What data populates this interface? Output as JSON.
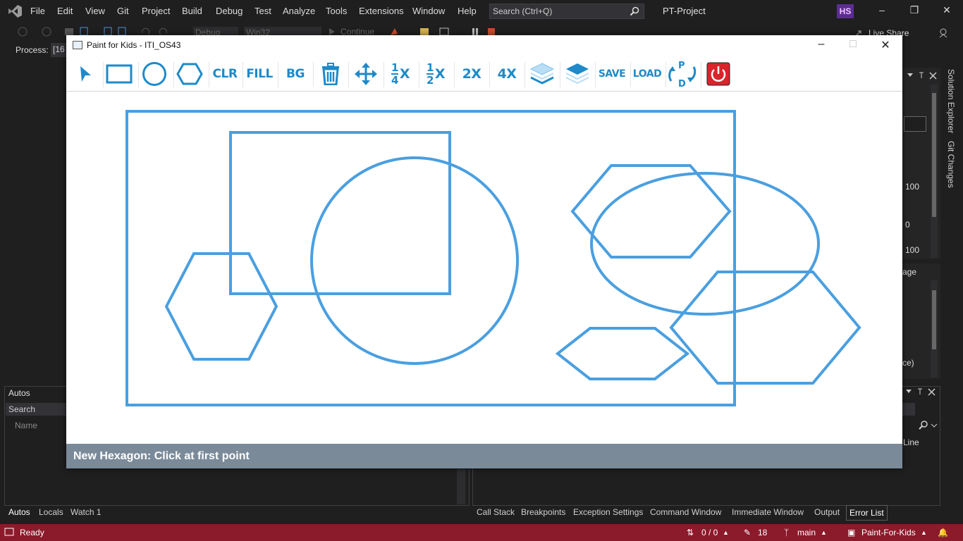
{
  "vs": {
    "menu": [
      "File",
      "Edit",
      "View",
      "Git",
      "Project",
      "Build",
      "Debug",
      "Test",
      "Analyze",
      "Tools",
      "Extensions",
      "Window",
      "Help"
    ],
    "search_placeholder": "Search (Ctrl+Q)",
    "project_name": "PT-Project",
    "avatar_initials": "HS",
    "toolbar": {
      "config": "Debug",
      "platform": "Win32",
      "continue": "Continue",
      "live_share": "Live Share"
    },
    "process_label": "Process:",
    "process_value": "[16",
    "right_panel": {
      "solution_explorer": "Solution Explorer",
      "git_changes": "Git Changes",
      "val_100a": "100",
      "val_0": "0",
      "val_100b": "100",
      "age_text": "age",
      "ce_text": "ce)",
      "line_text": "Line"
    },
    "autos": {
      "title": "Autos",
      "search": "Search",
      "name_col": "Name"
    },
    "bottom_tabs_left": [
      "Autos",
      "Locals",
      "Watch 1"
    ],
    "bottom_tabs_right": [
      "Call Stack",
      "Breakpoints",
      "Exception Settings",
      "Command Window",
      "Immediate Window",
      "Output",
      "Error List"
    ],
    "status": {
      "ready": "Ready",
      "changes": "0 / 0",
      "edits": "18",
      "branch": "main",
      "repo": "Paint-For-Kids"
    }
  },
  "paint": {
    "title": "Paint for Kids - ITI_OS43",
    "toolbar": {
      "clr": "CLR",
      "fill": "FILL",
      "bg": "BG",
      "save": "SAVE",
      "load": "LOAD",
      "two_x": "2X",
      "four_x": "4X",
      "quarter_num": "1",
      "quarter_den": "4",
      "half_num": "1",
      "half_den": "2",
      "x_mark": "X"
    },
    "status_text": "New Hexagon: Click at first point",
    "colors": {
      "shape_stroke": "#4a9fe0",
      "accent": "#1e8ac9",
      "status_bg": "#7a8a99",
      "exit_red": "#d9242b"
    }
  }
}
